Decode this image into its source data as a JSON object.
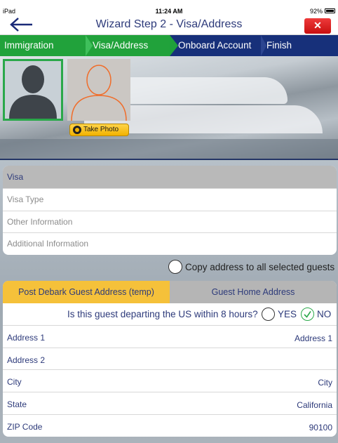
{
  "status_bar": {
    "carrier": "iPad",
    "time": "11:24 AM",
    "battery": "92%"
  },
  "nav": {
    "title": "Wizard Step 2 - Visa/Address",
    "close_label": "✕"
  },
  "steps": [
    "Immigration",
    "Visa/Address",
    "Onboard Account",
    "Finish"
  ],
  "photo": {
    "take_photo_label": "Take Photo"
  },
  "visa": {
    "header": "Visa",
    "fields": [
      {
        "placeholder": "Visa Type"
      },
      {
        "placeholder": "Other Information"
      },
      {
        "placeholder": "Additional Information"
      }
    ]
  },
  "copy_address_label": "Copy address to all selected guests",
  "address": {
    "tabs": [
      "Post Debark Guest Address (temp)",
      "Guest Home Address"
    ],
    "question": "Is this guest departing the US within 8 hours?",
    "yes_label": "YES",
    "no_label": "NO",
    "fields": [
      {
        "label": "Address 1",
        "value": "Address 1"
      },
      {
        "label": "Address 2",
        "value": ""
      },
      {
        "label": "City",
        "value": "City"
      },
      {
        "label": "State",
        "value": "California"
      },
      {
        "label": "ZIP Code",
        "value": "90100"
      }
    ]
  },
  "colors": {
    "step_done": "#21a23b",
    "step_todo": "#17307a",
    "accent": "#f5c13a",
    "close": "#d41e1e"
  }
}
